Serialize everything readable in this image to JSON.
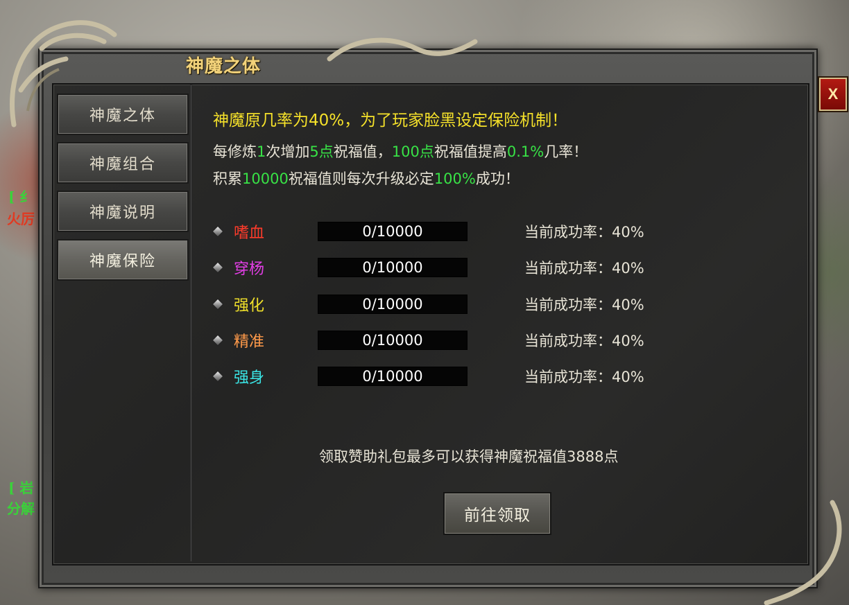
{
  "window": {
    "title": "神魔之体",
    "close_label": "X"
  },
  "sidebar": {
    "items": [
      {
        "label": "神魔之体",
        "active": false
      },
      {
        "label": "神魔组合",
        "active": false
      },
      {
        "label": "神魔说明",
        "active": false
      },
      {
        "label": "神魔保险",
        "active": true
      }
    ]
  },
  "intro": {
    "headline": "神魔原几率为40%，为了玩家脸黑设定保险机制！",
    "line2": {
      "p1": "每修炼",
      "v1": "1",
      "p2": "次增加",
      "v2": "5点",
      "p3": "祝福值，",
      "v3": "100点",
      "p4": "祝福值提高",
      "v4": "0.1%",
      "p5": "几率！"
    },
    "line3": {
      "p1": "积累",
      "v1": "10000",
      "p2": "祝福值则每次升级必定",
      "v2": "100%",
      "p3": "成功！"
    }
  },
  "stats": [
    {
      "name": "嗜血",
      "color": "#ff3b2b",
      "progress_text": "0/10000",
      "progress": 0,
      "rate_label": "当前成功率：",
      "rate": "40%"
    },
    {
      "name": "穿杨",
      "color": "#e33ee6",
      "progress_text": "0/10000",
      "progress": 0,
      "rate_label": "当前成功率：",
      "rate": "40%"
    },
    {
      "name": "强化",
      "color": "#f0e02a",
      "progress_text": "0/10000",
      "progress": 0,
      "rate_label": "当前成功率：",
      "rate": "40%"
    },
    {
      "name": "精准",
      "color": "#ff9a4a",
      "progress_text": "0/10000",
      "progress": 0,
      "rate_label": "当前成功率：",
      "rate": "40%"
    },
    {
      "name": "强身",
      "color": "#3ae6e6",
      "progress_text": "0/10000",
      "progress": 0,
      "rate_label": "当前成功率：",
      "rate": "40%"
    }
  ],
  "footer": {
    "note": "领取赞助礼包最多可以获得神魔祝福值3888点",
    "go_button": "前往领取"
  },
  "background": {
    "left_text_1": "[ 纟",
    "left_text_2": "火厉",
    "left_text_3": "[ 岩",
    "left_text_4": "分解"
  }
}
